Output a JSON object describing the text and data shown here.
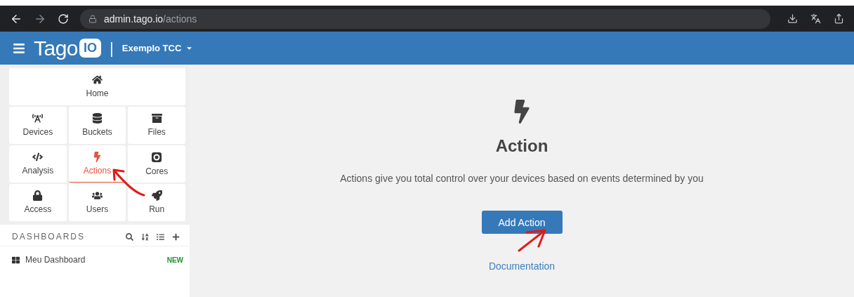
{
  "browser": {
    "url_host": "admin.tago.io",
    "url_path": "/actions"
  },
  "header": {
    "logo_text": "Tago",
    "logo_badge": "IO",
    "separator": "|",
    "account": "Exemplo TCC"
  },
  "sidebar": {
    "tiles": [
      {
        "label": "Home",
        "kind": "home",
        "selected": false
      },
      {
        "label": "Devices",
        "kind": "devices",
        "selected": false
      },
      {
        "label": "Buckets",
        "kind": "buckets",
        "selected": false
      },
      {
        "label": "Files",
        "kind": "files",
        "selected": false
      },
      {
        "label": "Analysis",
        "kind": "analysis",
        "selected": false
      },
      {
        "label": "Actions",
        "kind": "actions",
        "selected": true
      },
      {
        "label": "Cores",
        "kind": "cores",
        "selected": false
      },
      {
        "label": "Access",
        "kind": "access",
        "selected": false
      },
      {
        "label": "Users",
        "kind": "users",
        "selected": false
      },
      {
        "label": "Run",
        "kind": "run",
        "selected": false
      }
    ],
    "dashboards": {
      "title": "DASHBOARDS",
      "items": [
        {
          "name": "Meu Dashboard",
          "badge": "NEW"
        }
      ]
    }
  },
  "main": {
    "title": "Action",
    "description": "Actions give you total control over your devices based on events determined by you",
    "button": "Add Action",
    "link": "Documentation"
  }
}
